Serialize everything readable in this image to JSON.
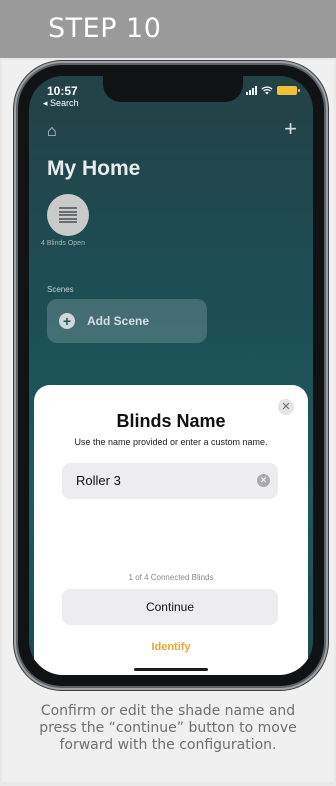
{
  "banner": {
    "title": "STEP 10"
  },
  "phone": {
    "status_bar": {
      "time": "10:57",
      "back_label": "◂ Search"
    },
    "home": {
      "title": "My Home",
      "device_caption": "4 Blinds Open",
      "scenes_label": "Scenes",
      "add_scene_label": "Add Scene"
    },
    "sheet": {
      "title": "Blinds Name",
      "subtitle": "Use the name provided or enter a custom name.",
      "name_value": "Roller 3",
      "count_text": "1 of 4 Connected Blinds",
      "continue_label": "Continue",
      "identify_label": "Identify"
    },
    "colors": {
      "accent": "#e8a634",
      "battery": "#f0c23a",
      "screen_bg": "#1f5a60"
    },
    "icons": [
      "home-icon",
      "plus-icon",
      "blinds-icon",
      "add-icon",
      "close-icon",
      "clear-icon",
      "wifi-icon",
      "battery-icon",
      "signal-icon"
    ]
  },
  "caption": "Confirm or edit the shade name and press the “continue” button to move forward with the configuration."
}
